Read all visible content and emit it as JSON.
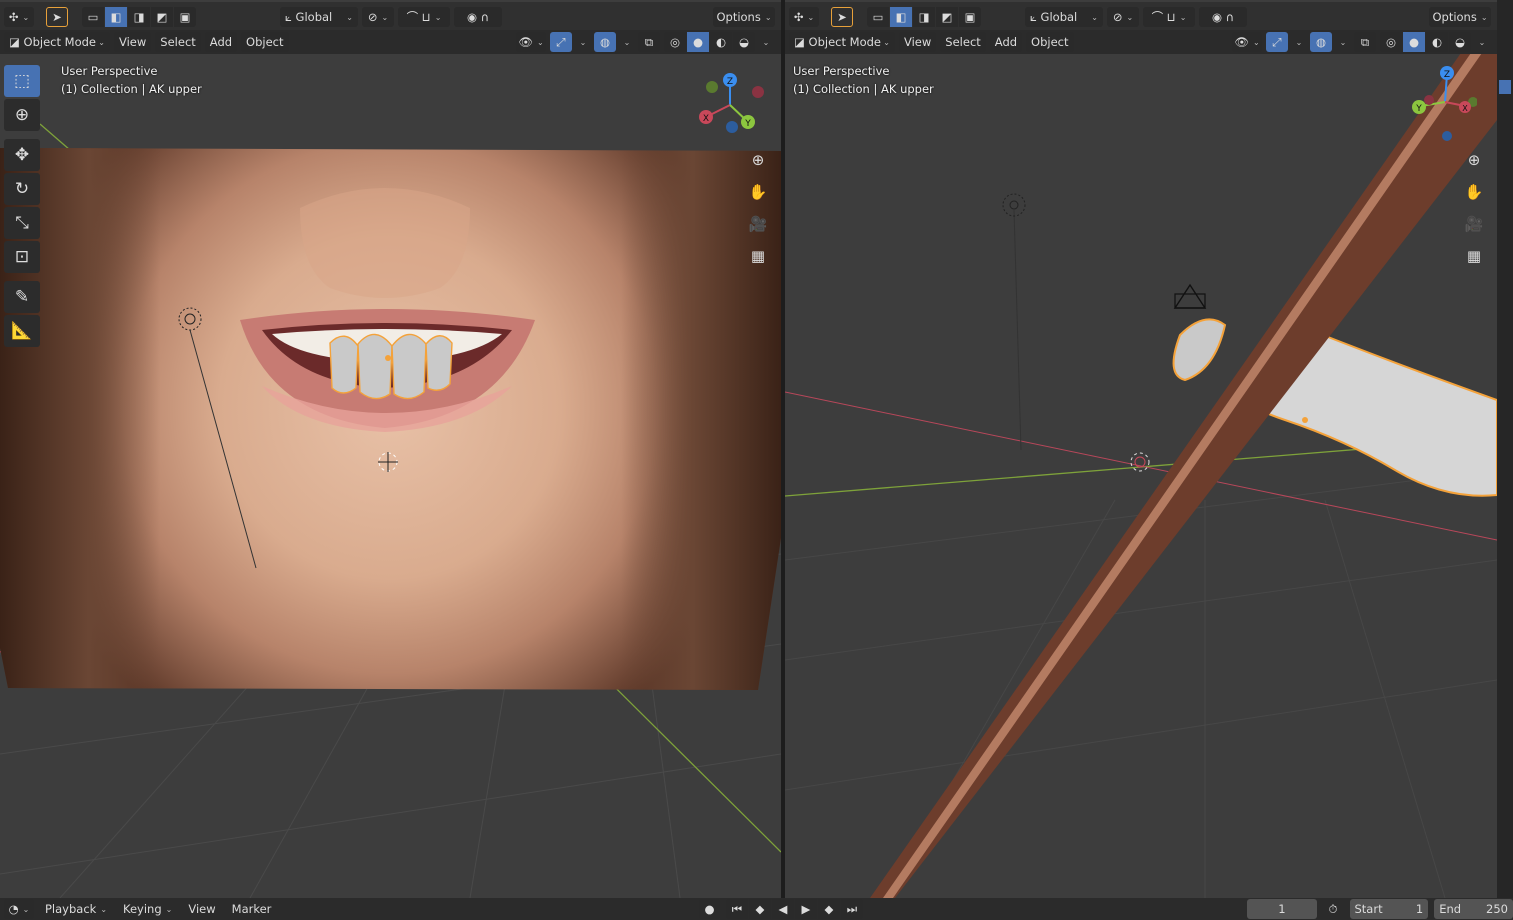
{
  "left_viewport": {
    "header": {
      "orientation": "Global",
      "options": "Options"
    },
    "subheader": {
      "mode": "Object Mode",
      "menus": [
        "View",
        "Select",
        "Add",
        "Object"
      ]
    },
    "overlay": {
      "perspective": "User Perspective",
      "collection": "(1) Collection | AK upper"
    },
    "gizmo": {
      "x": "X",
      "y": "Y",
      "z": "Z"
    }
  },
  "right_viewport": {
    "header": {
      "orientation": "Global",
      "options": "Options"
    },
    "subheader": {
      "mode": "Object Mode",
      "menus": [
        "View",
        "Select",
        "Add",
        "Object"
      ]
    },
    "overlay": {
      "perspective": "User Perspective",
      "collection": "(1) Collection | AK upper"
    },
    "gizmo": {
      "x": "X",
      "y": "Y",
      "z": "Z"
    }
  },
  "timeline": {
    "menus": [
      "Playback",
      "Keying",
      "View",
      "Marker"
    ],
    "current_frame": "1",
    "start_label": "Start",
    "start_value": "1",
    "end_label": "End",
    "end_value": "250"
  },
  "colors": {
    "active": "#4772b3",
    "selection_outline": "#f4a23a",
    "axis_x": "#c8485a",
    "axis_y": "#8cc63f",
    "axis_z": "#3a8ef0"
  }
}
